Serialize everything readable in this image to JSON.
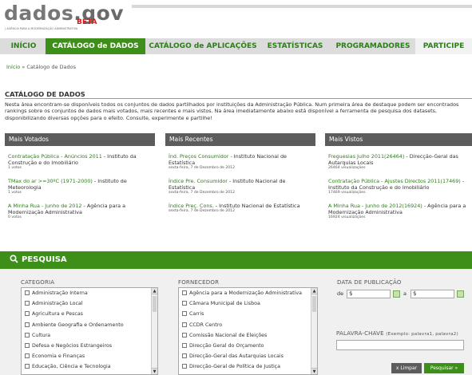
{
  "header": {
    "logo_left": "dados",
    "logo_right": ".gov",
    "beta": "BETA",
    "tagline": "| AGÊNCIA PARA A MODERNIZAÇÃO ADMINISTRATIVA"
  },
  "nav": [
    {
      "label": "INÍCIO"
    },
    {
      "label": "CATÁLOGO de DADOS",
      "active": true
    },
    {
      "label": "CATÁLOGO de APLICAÇÕES"
    },
    {
      "label": "ESTATÍSTICAS"
    },
    {
      "label": "PROGRAMADORES"
    },
    {
      "label": "PARTICIPE"
    }
  ],
  "breadcrumb": {
    "home": "Início",
    "sep": " » ",
    "current": "Catálogo de Dados"
  },
  "page": {
    "title": "CATÁLOGO DE DADOS",
    "intro": "Nesta área encontram-se disponíveis todos os conjuntos de dados partilhados por instituições da Administração Pública. Num primeira área de destaque podem ser encontrados rankings sobre os conjuntos de dados mais votados, mais recentes e mais vistos. Na área imediatamente abaixo está disponível a ferramenta de pesquisa dos datasets, disponibilizando diversas opções para o efeito. Consulte, experimente e partilhe!"
  },
  "columns": [
    {
      "title": "Mais Votados",
      "entries": [
        {
          "link": "Contratação Pública - Anúncios 2011",
          "rest": " - Instituto da Construção e do Imobiliário",
          "meta": "1 votos"
        },
        {
          "link": "TMax do ar >=30ºC (1971-2000)",
          "rest": " - Instituto de Meteorologia",
          "meta": "1 votos"
        },
        {
          "link": "A Minha Rua - Junho de 2012",
          "rest": " - Agência para a Modernização Administrativa",
          "meta": "0 votos"
        }
      ]
    },
    {
      "title": "Mais Recentes",
      "entries": [
        {
          "link": "Índ. Preços Consumidor",
          "rest": " - Instituto Nacional de Estatística",
          "meta": "sexta-feira, 7 de Dezembro de 2012"
        },
        {
          "link": "Índice Pre. Consumidor",
          "rest": " - Instituto Nacional de Estatística",
          "meta": "sexta-feira, 7 de Dezembro de 2012"
        },
        {
          "link": "Índice Preç. Cons.",
          "rest": " - Instituto Nacional de Estatística",
          "meta": "sexta-feira, 7 de Dezembro de 2012"
        }
      ]
    },
    {
      "title": "Mais Vistos",
      "entries": [
        {
          "link": "Freguesias Julho 2011(26464)",
          "rest": " - Direcção-Geral das Autarquias Locais",
          "meta": "26464 visualizações"
        },
        {
          "link": "Contratação Pública - Ajustes Directos 2011(17469)",
          "rest": " - Instituto da Construção e do Imobiliário",
          "meta": "17469 visualizações"
        },
        {
          "link": "A Minha Rua - Junho de 2012(16924)",
          "rest": " - Agência para a Modernização Administrativa",
          "meta": "16924 visualizações"
        }
      ]
    }
  ],
  "search": {
    "title": "PESQUISA",
    "category_label": "CATEGORIA",
    "categories": [
      "Administração Interna",
      "Administração Local",
      "Agricultura e Pescas",
      "Ambiente Geografia e Ordenamento",
      "Cultura",
      "Defesa e Negócios Estrangeiros",
      "Economia e Finanças",
      "Educação, Ciência e Tecnologia"
    ],
    "provider_label": "FORNECEDOR",
    "providers": [
      "Agência para a Modernização Administrativa",
      "Câmara Municipal de Lisboa",
      "Carris",
      "CCDR Centro",
      "Comissão Nacional de Eleições",
      "Direcção Geral do Orçamento",
      "Direcção-Geral das Autarquias Locais",
      "Direcção-Geral de Política de Justiça"
    ],
    "date_label": "DATA DE PUBLICAÇÃO",
    "date_from_label": "de",
    "date_to_label": "a",
    "date_from_value": "$",
    "date_to_value": "$",
    "keyword_label": "PALAVRA-CHAVE",
    "keyword_hint": "(Exemplo: palavra1, palavra2)",
    "clear_label": "x Limpar",
    "search_label": "Pesquisar »"
  }
}
